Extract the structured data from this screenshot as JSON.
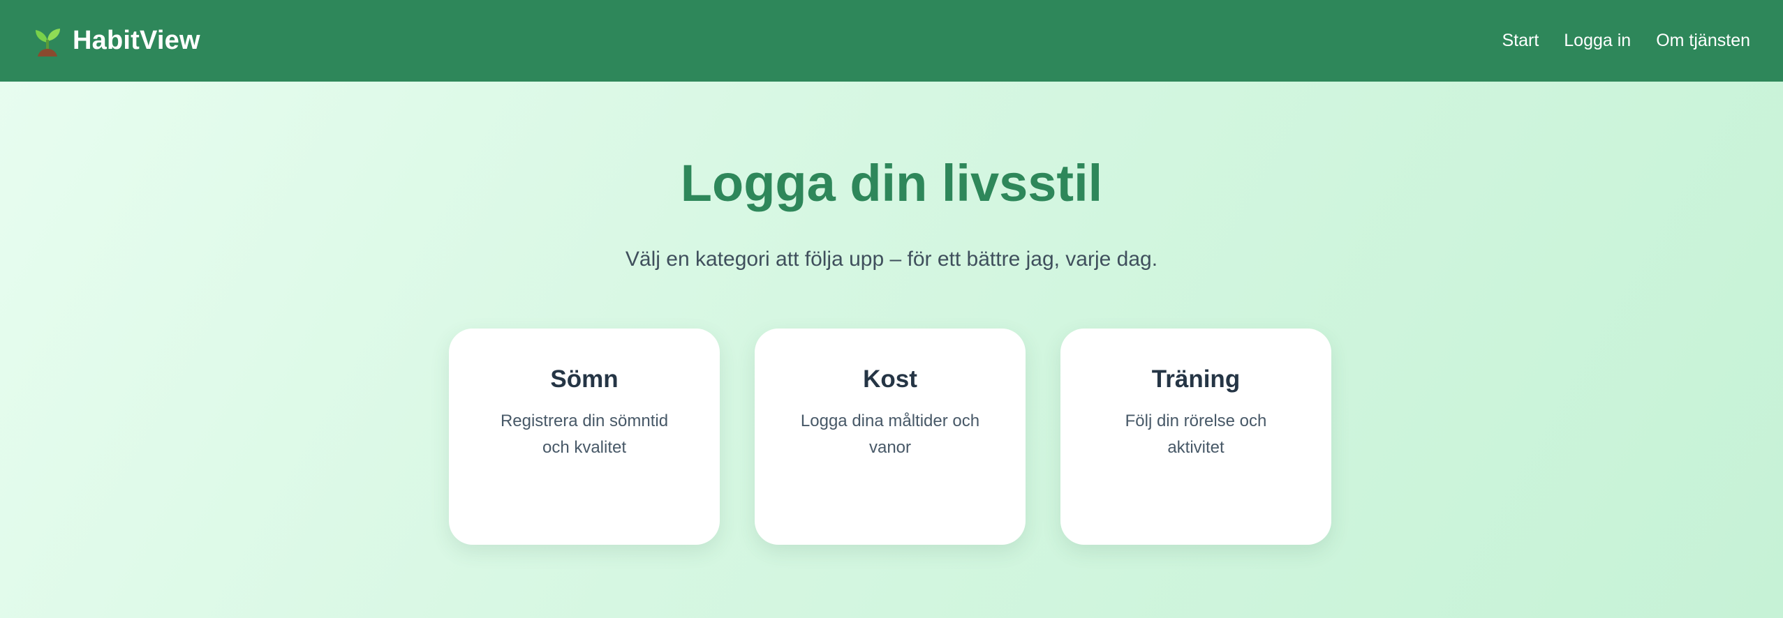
{
  "header": {
    "brand_name": "HabitView",
    "brand_icon": "seedling-icon",
    "background_color": "#2e875a",
    "nav": [
      {
        "label": "Start"
      },
      {
        "label": "Logga in"
      },
      {
        "label": "Om tjänsten"
      }
    ]
  },
  "hero": {
    "title": "Logga din livsstil",
    "subtitle": "Välj en kategori att följa upp – för ett bättre jag, varje dag."
  },
  "categories": [
    {
      "title": "Sömn",
      "description": "Registrera din sömntid och kvalitet"
    },
    {
      "title": "Kost",
      "description": "Logga dina måltider och vanor"
    },
    {
      "title": "Träning",
      "description": "Följ din rörelse och aktivitet"
    }
  ],
  "colors": {
    "accent": "#2e875a",
    "card_title": "#253545",
    "text_muted": "#475867"
  }
}
